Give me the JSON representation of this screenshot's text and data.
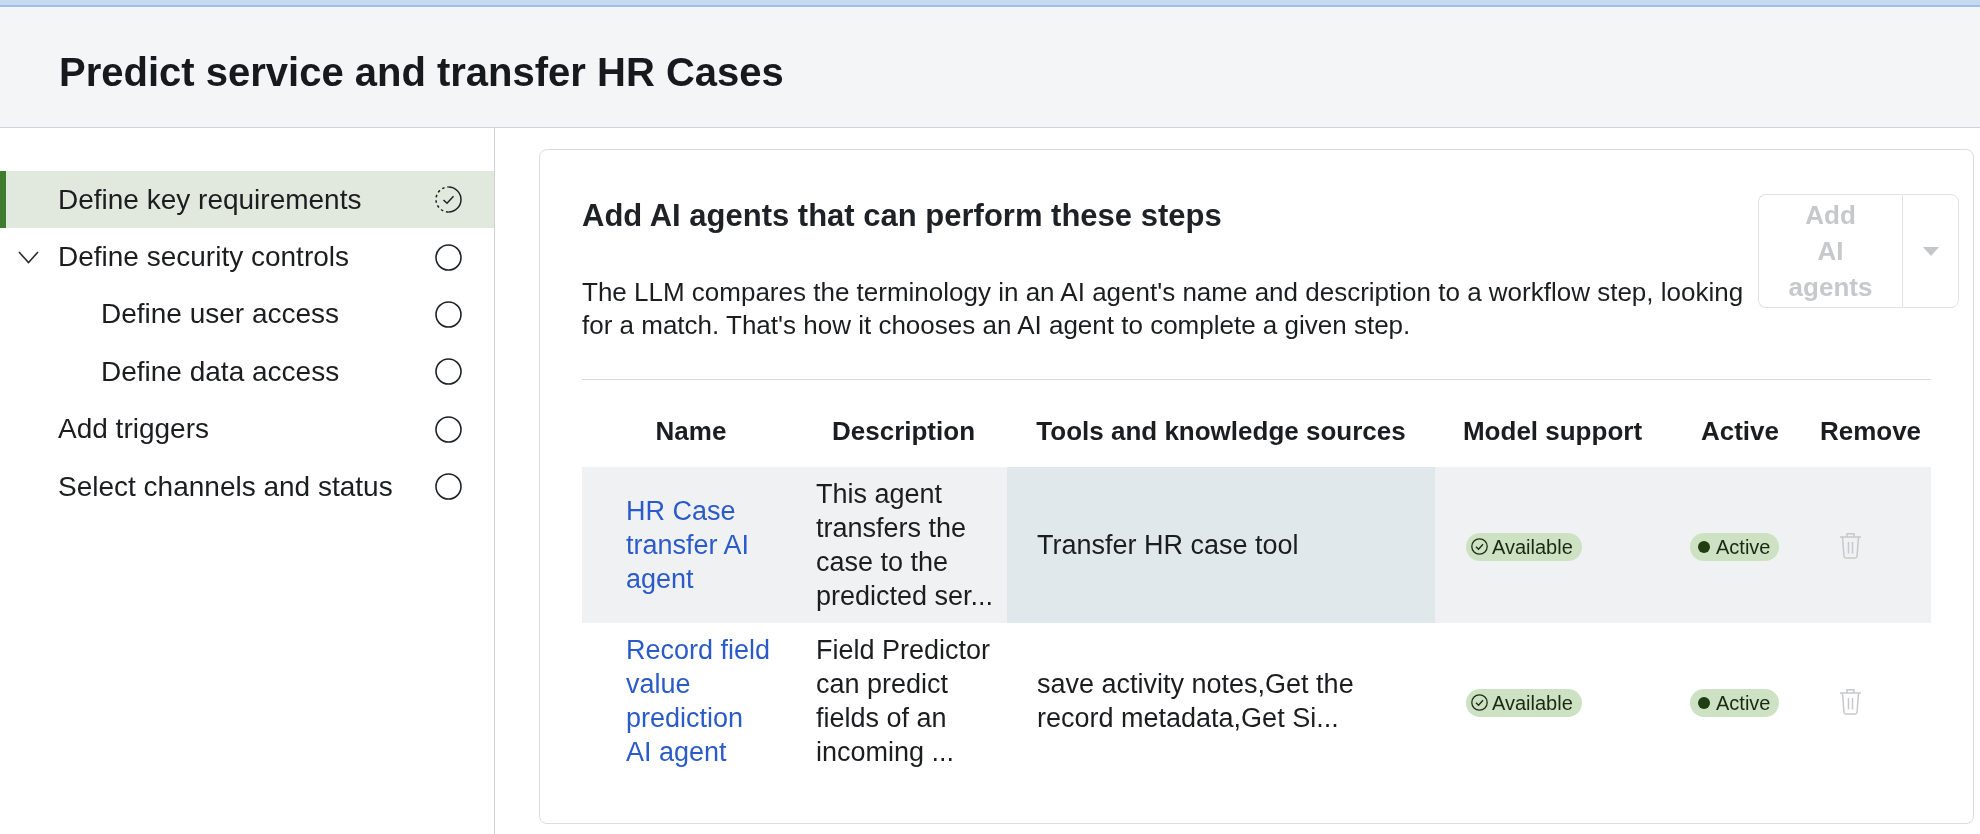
{
  "header": {
    "title": "Predict service and transfer HR Cases"
  },
  "steps": [
    {
      "label": "Define key requirements",
      "selected": true,
      "kind": "in_progress"
    },
    {
      "label": "Define security controls",
      "selected": false,
      "kind": "not_started",
      "expanded": true,
      "children": [
        {
          "label": "Define user access",
          "selected": false,
          "kind": "not_started"
        },
        {
          "label": "Define data access",
          "selected": false,
          "kind": "not_started"
        }
      ]
    },
    {
      "label": "Add triggers",
      "selected": false,
      "kind": "not_started"
    },
    {
      "label": "Select channels and status",
      "selected": false,
      "kind": "not_started"
    }
  ],
  "agents_panel": {
    "title": "Add AI agents that can perform these steps",
    "description": "The LLM compares the terminology in an AI agent's name and description to a workflow step, looking for a match. That's how it chooses an AI agent to complete a given step.",
    "add_button": {
      "label": "Add AI agents",
      "disabled": true
    },
    "table": {
      "columns": [
        "Name",
        "Description",
        "Tools and knowledge sources",
        "Model support",
        "Active",
        "Remove"
      ],
      "rows": [
        {
          "name": "HR Case transfer AI agent",
          "description": "This agent transfers the case to the predicted ser...",
          "tools": "Transfer HR case tool",
          "model_support": "Available",
          "active": "Active",
          "hovered": true,
          "tools_hovered": true,
          "remove_disabled": true
        },
        {
          "name": "Record field value prediction AI agent",
          "description": "Field Predictor can predict fields of an incoming ...",
          "tools": "save activity notes,Get the record metadata,Get Si...",
          "model_support": "Available",
          "active": "Active",
          "hovered": false,
          "tools_hovered": false,
          "remove_disabled": true
        }
      ]
    }
  }
}
